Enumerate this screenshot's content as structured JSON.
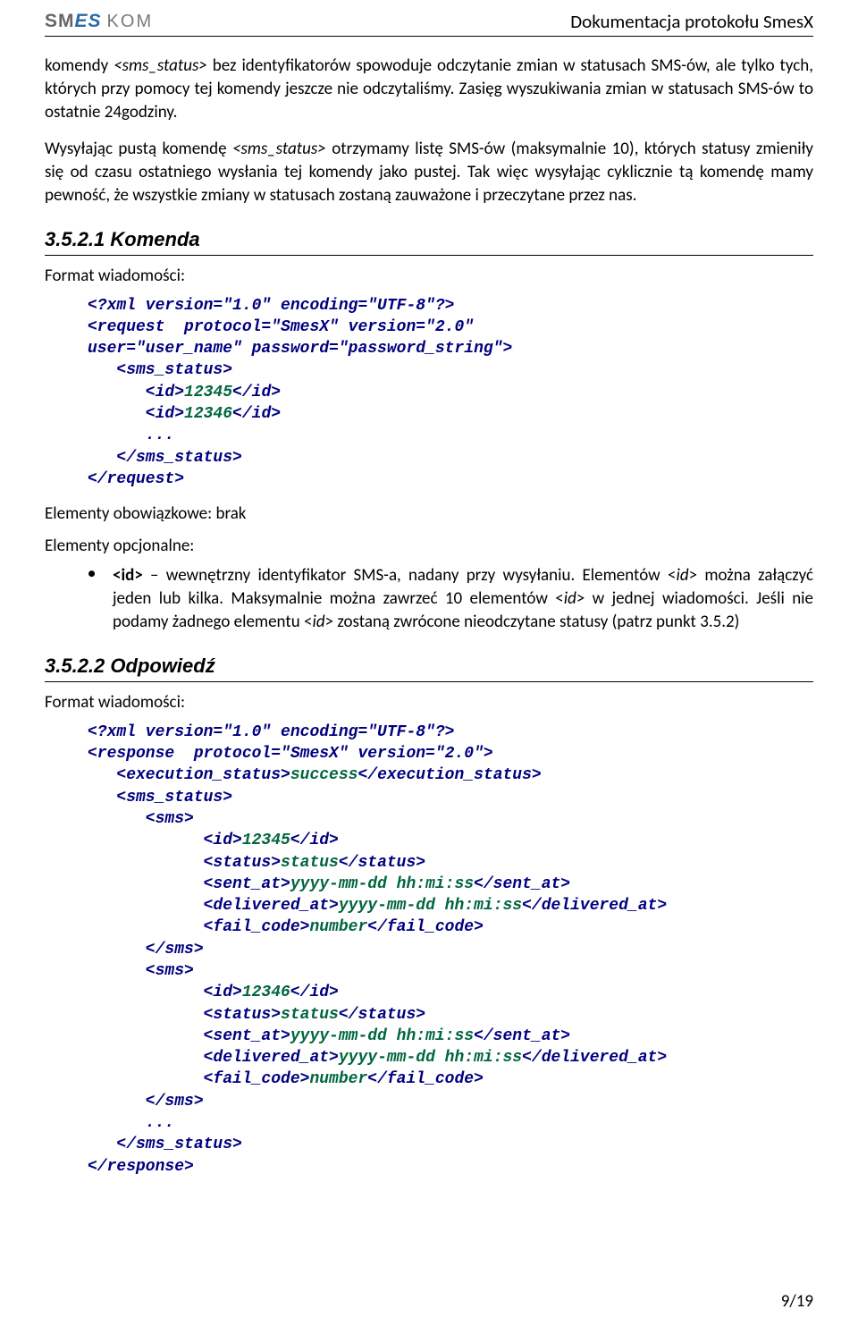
{
  "header": {
    "logo_smes_letters": [
      "S",
      "M",
      "E",
      "S"
    ],
    "logo_kom": "KOM",
    "title": "Dokumentacja protokołu SmesX"
  },
  "intro": {
    "p1_pre": "komendy ",
    "p1_tag": "<sms_status>",
    "p1_post": " bez identyfikatorów spowoduje odczytanie zmian w statusach SMS-ów, ale tylko tych, których przy pomocy tej komendy jeszcze nie odczytaliśmy. Zasięg wyszukiwania  zmian w statusach SMS-ów to ostatnie 24godziny.",
    "p2_pre": "Wysyłając pustą komendę ",
    "p2_tag": "<sms_status>",
    "p2_post": " otrzymamy listę SMS-ów (maksymalnie 10), których statusy zmieniły się od czasu ostatniego wysłania tej komendy jako pustej. Tak więc wysyłając cyklicznie tą komendę mamy pewność, że wszystkie zmiany w statusach zostaną zauważone i przeczytane przez nas."
  },
  "s3521": {
    "heading": "3.5.2.1 Komenda",
    "format_label": "Format wiadomości:",
    "code": {
      "l1": "<?xml version=\"1.0\" encoding=\"UTF-8\"?>",
      "l2": "<request  protocol=\"SmesX\" version=\"2.0\"",
      "l3": "user=\"user_name\" password=\"password_string\">",
      "l4": "   <sms_status>",
      "l5a": "      <id>",
      "l5v": "12345",
      "l5b": "</id>",
      "l6a": "      <id>",
      "l6v": "12346",
      "l6b": "</id>",
      "l7": "      ...",
      "l8": "   </sms_status>",
      "l9": "</request>"
    },
    "mandatory": "Elementy obowiązkowe: brak",
    "optional_label": "Elementy opcjonalne:",
    "bullet_pre": "<id>",
    "bullet_text": " – wewnętrzny identyfikator SMS-a, nadany przy wysyłaniu. Elementów <",
    "bullet_tag1": "id",
    "bullet_text2": "> można załączyć jeden lub kilka. Maksymalnie można zawrzeć 10 elementów <",
    "bullet_tag2": "id",
    "bullet_text3": "> w jednej wiadomości. Jeśli nie podamy żadnego elementu <",
    "bullet_tag3": "id",
    "bullet_text4": "> zostaną zwrócone nieodczytane statusy (patrz punkt 3.5.2)"
  },
  "s3522": {
    "heading": "3.5.2.2 Odpowiedź",
    "format_label": "Format wiadomości:",
    "code": {
      "l1": "<?xml version=\"1.0\" encoding=\"UTF-8\"?>",
      "l2": "<response  protocol=\"SmesX\" version=\"2.0\">",
      "l3a": "   <execution_status>",
      "l3v": "success",
      "l3b": "</execution_status>",
      "l4": "   <sms_status>",
      "l5": "      <sms>",
      "l6a": "            <id>",
      "l6v": "12345",
      "l6b": "</id>",
      "l7a": "            <status>",
      "l7v": "status",
      "l7b": "</status>",
      "l8a": "            <sent_at>",
      "l8v": "yyyy-mm-dd hh:mi:ss",
      "l8b": "</sent_at>",
      "l9a": "            <delivered_at>",
      "l9v": "yyyy-mm-dd hh:mi:ss",
      "l9b": "</delivered_at>",
      "l10a": "            <fail_code>",
      "l10v": "number",
      "l10b": "</fail_code>",
      "l11": "      </sms>",
      "l12": "      <sms>",
      "l13a": "            <id>",
      "l13v": "12346",
      "l13b": "</id>",
      "l14a": "            <status>",
      "l14v": "status",
      "l14b": "</status>",
      "l15a": "            <sent_at>",
      "l15v": "yyyy-mm-dd hh:mi:ss",
      "l15b": "</sent_at>",
      "l16a": "            <delivered_at>",
      "l16v": "yyyy-mm-dd hh:mi:ss",
      "l16b": "</delivered_at>",
      "l17a": "            <fail_code>",
      "l17v": "number",
      "l17b": "</fail_code>",
      "l18": "      </sms>",
      "l19": "      ...",
      "l20": "   </sms_status>",
      "l21": "</response>"
    }
  },
  "footer": {
    "page": "9/19"
  }
}
